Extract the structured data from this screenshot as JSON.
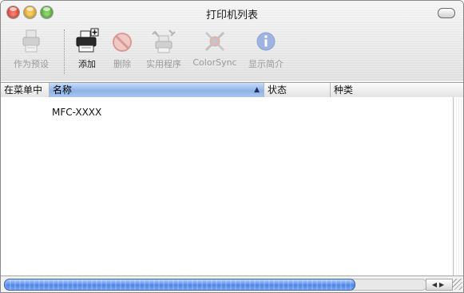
{
  "window": {
    "title": "打印机列表"
  },
  "toolbar": {
    "items": [
      {
        "label": "作为预设",
        "icon": "default-printer-icon",
        "enabled": false
      },
      {
        "label": "添加",
        "icon": "add-printer-icon",
        "enabled": true
      },
      {
        "label": "删除",
        "icon": "delete-icon",
        "enabled": false
      },
      {
        "label": "实用程序",
        "icon": "utility-icon",
        "enabled": false
      },
      {
        "label": "ColorSync",
        "icon": "colorsync-icon",
        "enabled": false
      },
      {
        "label": "显示简介",
        "icon": "info-icon",
        "enabled": false
      }
    ]
  },
  "table": {
    "columns": [
      "在菜单中",
      "名称",
      "状态",
      "种类"
    ],
    "sorted_column": "名称",
    "sort_direction": "ascending",
    "rows": [
      {
        "in_menu": "",
        "name": "MFC-XXXX",
        "status": "",
        "kind": ""
      }
    ]
  },
  "colors": {
    "sort_header": "#8fb3e8",
    "scroll_thumb": "#4f85e6"
  }
}
